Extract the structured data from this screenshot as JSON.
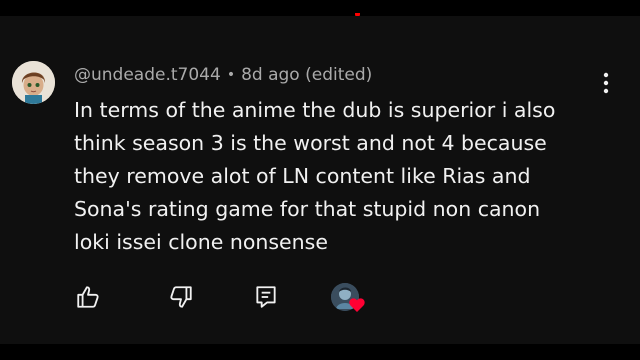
{
  "colors": {
    "page_background": "#000000",
    "panel_background": "#0f0f0f",
    "primary_text": "#f1f1f1",
    "secondary_text": "#aaaaaa",
    "heart": "#ff0033"
  },
  "comment": {
    "author": "@undeade.t7044",
    "separator": "•",
    "timestamp": "8d ago (edited)",
    "text_lines": [
      "In terms of the anime the dub is superior i also",
      "think season 3 is the worst and not 4 because",
      "they remove alot of LN content like Rias and",
      "Sona's rating game for that stupid non canon",
      "loki issei clone nonsense"
    ],
    "avatar": "cartoon-character-avatar"
  },
  "actions": {
    "like": "thumbs-up-icon",
    "dislike": "thumbs-down-icon",
    "reply": "reply-icon",
    "more": "more-vertical-icon",
    "creator_heart": "creator-heart-icon"
  }
}
